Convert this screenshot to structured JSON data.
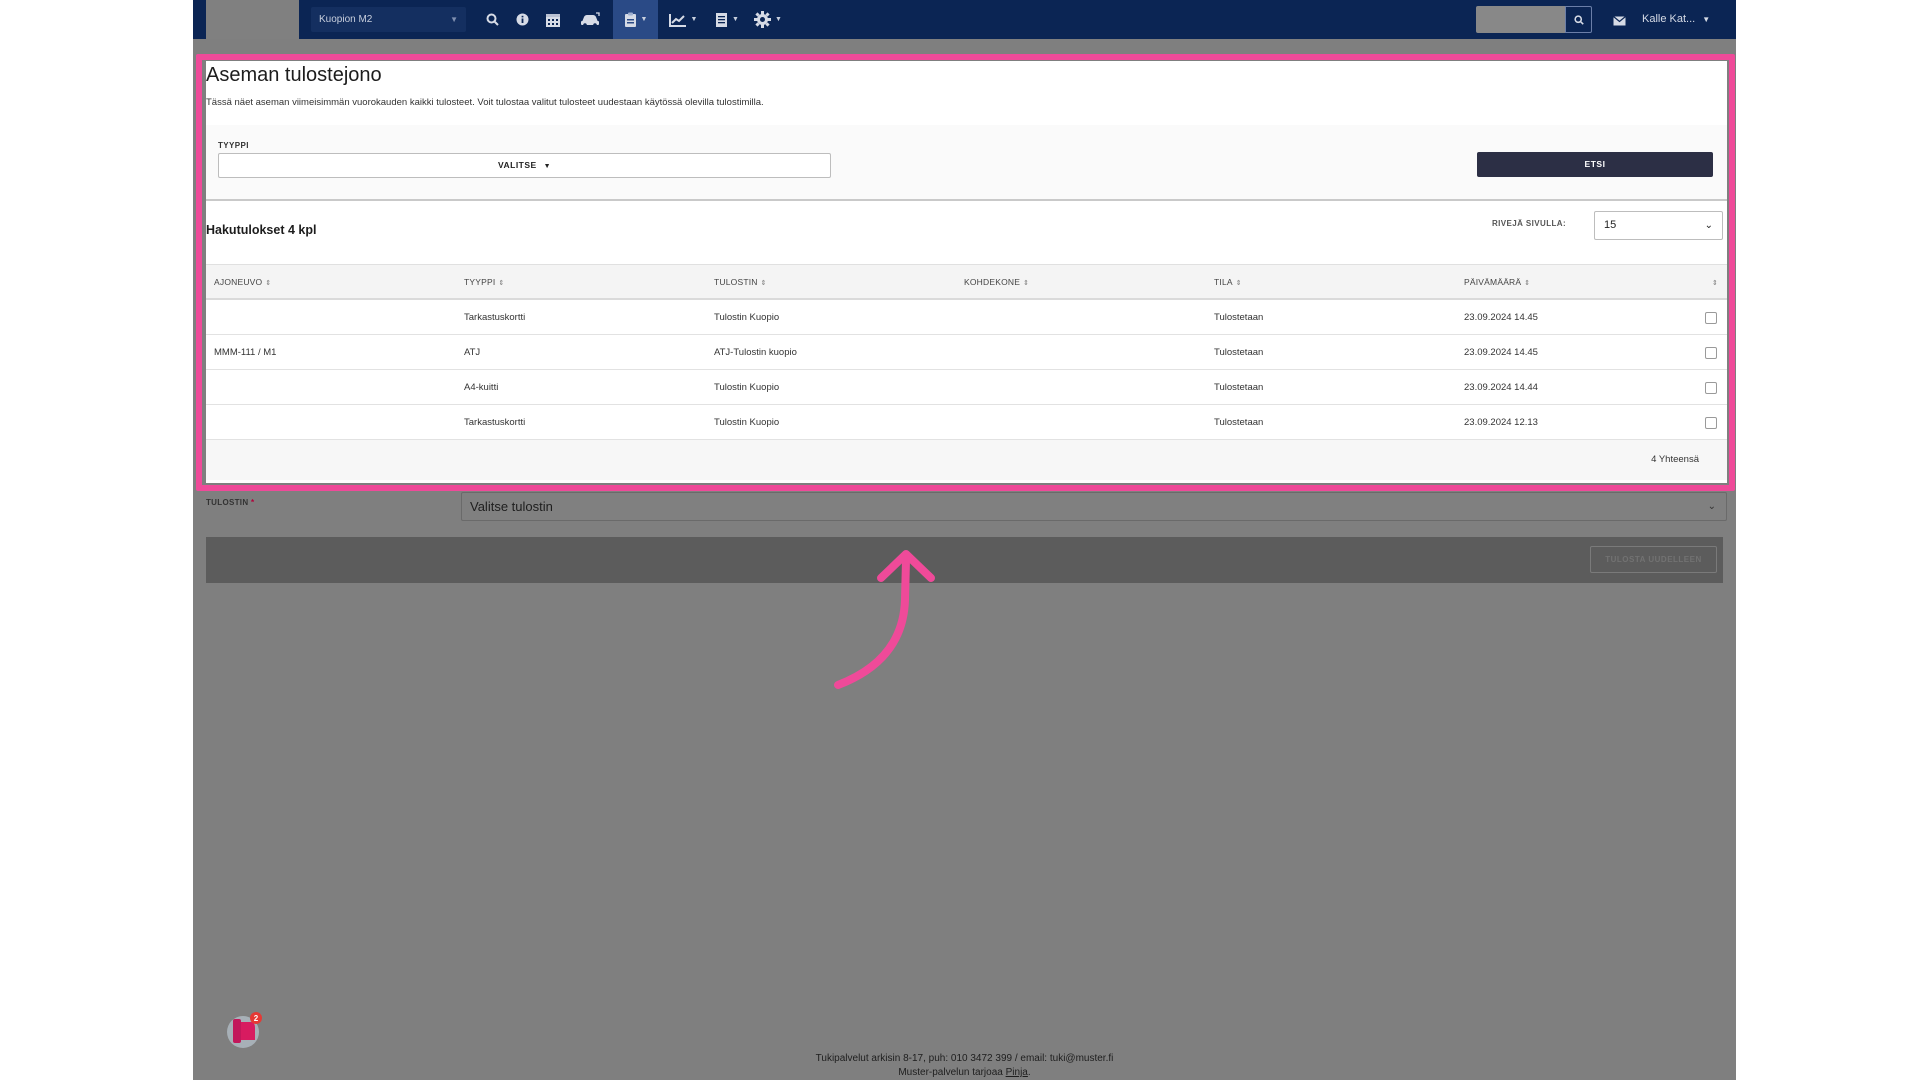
{
  "navbar": {
    "station": "Kuopion M2",
    "user": "Kalle Kat...",
    "icons": [
      "search-icon",
      "info-icon",
      "calendar-icon",
      "car-icon",
      "clipboard-icon",
      "chart-icon",
      "document-icon",
      "gear-icon",
      "mail-icon"
    ]
  },
  "modal": {
    "title": "Aseman tulostejono",
    "description": "Tässä näet aseman viimeisimmän vuorokauden kaikki tulosteet. Voit tulostaa valitut tulosteet uudestaan käytössä olevilla tulostimilla.",
    "filter_label": "TYYPPI",
    "filter_select": "VALITSE",
    "search_button": "ETSI",
    "results_title": "Hakutulokset 4 kpl",
    "rows_label": "RIVEJÄ SIVULLA:",
    "rows_value": "15",
    "columns": [
      "AJONEUVO",
      "TYYPPI",
      "TULOSTIN",
      "KOHDEKONE",
      "TILA",
      "PÄIVÄMÄÄRÄ"
    ],
    "rows": [
      {
        "ajoneuvo": "",
        "tyyppi": "Tarkastuskortti",
        "tulostin": "Tulostin Kuopio",
        "kohdekone": "",
        "tila": "Tulostetaan",
        "paivamaara": "23.09.2024 14.45"
      },
      {
        "ajoneuvo": "MMM-111 / M1",
        "tyyppi": "ATJ",
        "tulostin": "ATJ-Tulostin kuopio",
        "kohdekone": "",
        "tila": "Tulostetaan",
        "paivamaara": "23.09.2024 14.45"
      },
      {
        "ajoneuvo": "",
        "tyyppi": "A4-kuitti",
        "tulostin": "Tulostin Kuopio",
        "kohdekone": "",
        "tila": "Tulostetaan",
        "paivamaara": "23.09.2024 14.44"
      },
      {
        "ajoneuvo": "",
        "tyyppi": "Tarkastuskortti",
        "tulostin": "Tulostin Kuopio",
        "kohdekone": "",
        "tila": "Tulostetaan",
        "paivamaara": "23.09.2024 12.13"
      }
    ],
    "total": "4 Yhteensä"
  },
  "background_form": {
    "printer_label": "TULOSTIN",
    "required_mark": "*",
    "printer_select": "Valitse tulostin",
    "reprint_button": "TULOSTA UUDELLEEN"
  },
  "footer": {
    "line1": "Tukipalvelut arkisin 8-17, puh: 010 3472 399 / email: tuki@muster.fi",
    "line2_prefix": "Muster-palvelun tarjoaa ",
    "line2_link": "Pinja",
    "line2_suffix": "."
  },
  "chat": {
    "badge_count": "2"
  },
  "colors": {
    "navbar": "#0b2554",
    "highlight": "#ef4a99",
    "button_dark": "#2c2f45",
    "overlay": "#7f7f7f"
  }
}
